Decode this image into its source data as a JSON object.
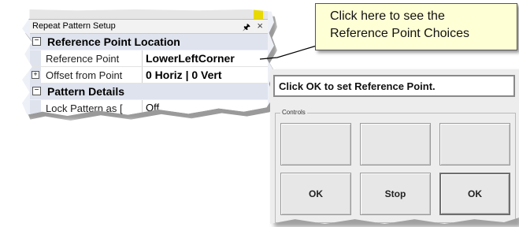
{
  "panel": {
    "title": "Repeat Pattern Setup",
    "pin_icon": "pin-icon",
    "close_icon": "close-icon",
    "categories": [
      {
        "label": "Reference Point Location",
        "toggle": "⊟"
      },
      {
        "label": "Pattern Details",
        "toggle": "⊟"
      }
    ],
    "properties": [
      {
        "name": "Reference Point",
        "value": "LowerLeftCorner"
      },
      {
        "name": "Offset from Point",
        "value": "0 Horiz | 0 Vert",
        "expand": "+"
      },
      {
        "name": "Lock Pattern as [",
        "value": "Off"
      }
    ],
    "accent_yellow": "#e8d900"
  },
  "callout": {
    "line1": "Click here to see the",
    "line2": "Reference Point Choices"
  },
  "controls": {
    "status_text": "Click OK to set Reference Point.",
    "group_label": "Controls",
    "buttons_top": [
      "",
      "",
      ""
    ],
    "buttons_bottom": [
      "OK",
      "Stop",
      "OK"
    ]
  }
}
